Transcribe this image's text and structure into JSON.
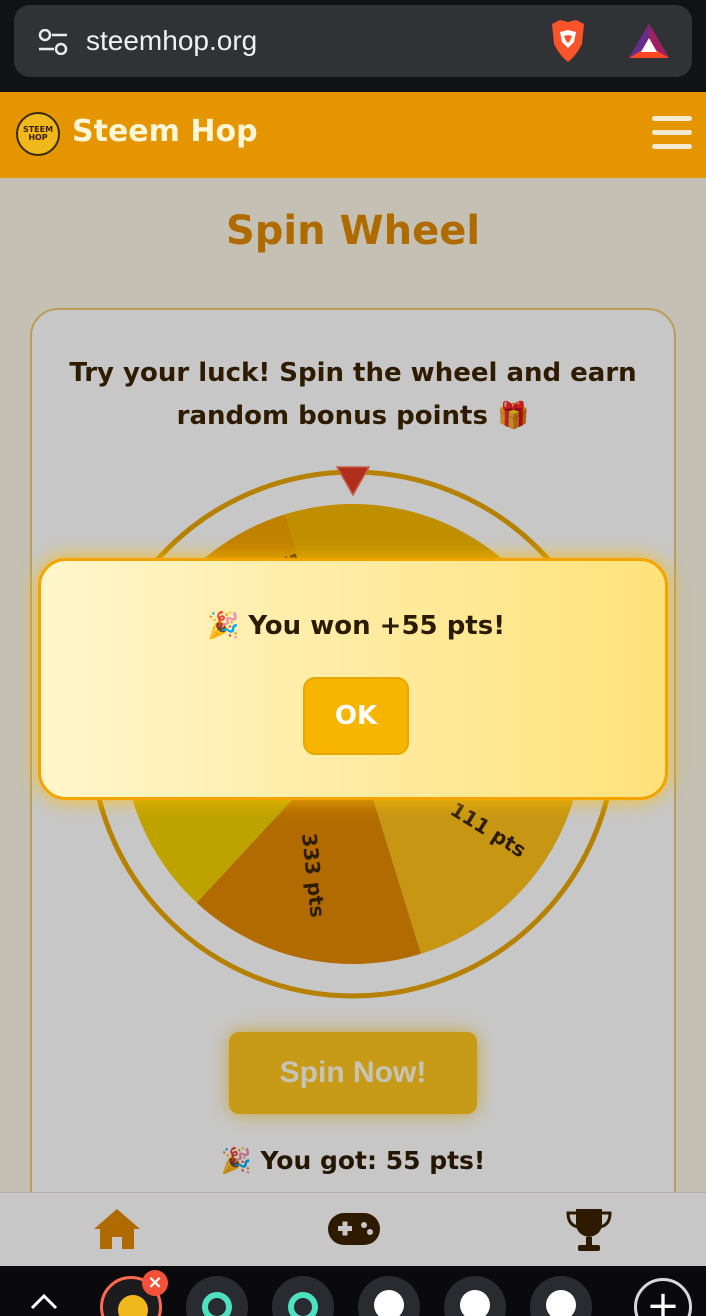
{
  "browser": {
    "url": "steemhop.org"
  },
  "header": {
    "logo_text": "STEEM HOP",
    "brand": "Steem Hop"
  },
  "page": {
    "title": "Spin Wheel",
    "intro": "Try your luck! Spin the wheel and earn random bonus points 🎁"
  },
  "wheel": {
    "visible_labels": [
      "111 pts",
      "333 pts"
    ],
    "segment_colors": [
      "#f5b800",
      "#f59c00",
      "#ffc21a",
      "#e58a00",
      "#f2d000",
      "#f7a600"
    ]
  },
  "actions": {
    "spin_label": "Spin Now!",
    "result": "🎉 You got: 55 pts!"
  },
  "modal": {
    "message": "🎉 You won +55 pts!",
    "ok_label": "OK"
  },
  "nav": {
    "items": [
      "home-icon",
      "gamepad-icon",
      "trophy-icon"
    ]
  },
  "colors": {
    "accent": "#e59500",
    "button": "#ffc61f",
    "text_dark": "#3b2300"
  }
}
